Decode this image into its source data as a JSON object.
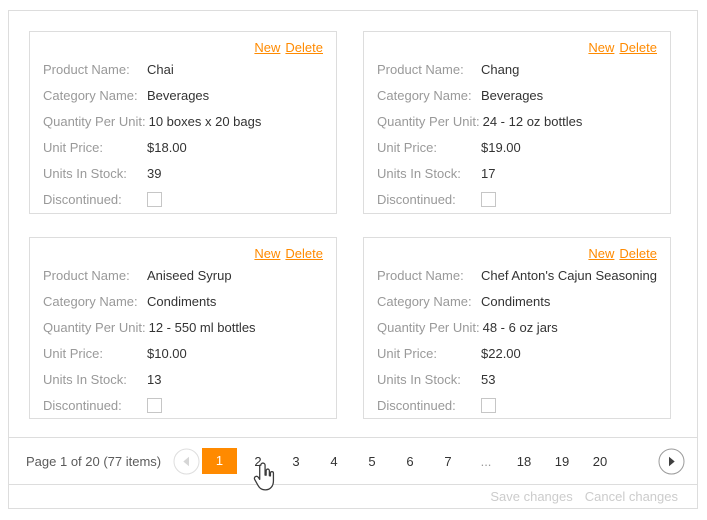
{
  "theme": {
    "accent": "#ff8a00",
    "border_color": "#dddddd",
    "label_color": "#999999",
    "value_color": "#333333",
    "disabled_link_color": "#cccccc"
  },
  "cards": [
    {
      "links": {
        "new": "New",
        "delete": "Delete"
      },
      "fields": [
        {
          "label": "Product Name:",
          "value": "Chai"
        },
        {
          "label": "Category Name:",
          "value": "Beverages"
        },
        {
          "label": "Quantity Per Unit:",
          "value": "10 boxes x 20 bags"
        },
        {
          "label": "Unit Price:",
          "value": "$18.00"
        },
        {
          "label": "Units In Stock:",
          "value": "39"
        }
      ],
      "discontinued_label": "Discontinued:",
      "discontinued": false
    },
    {
      "links": {
        "new": "New",
        "delete": "Delete"
      },
      "fields": [
        {
          "label": "Product Name:",
          "value": "Chang"
        },
        {
          "label": "Category Name:",
          "value": "Beverages"
        },
        {
          "label": "Quantity Per Unit:",
          "value": "24 - 12 oz bottles"
        },
        {
          "label": "Unit Price:",
          "value": "$19.00"
        },
        {
          "label": "Units In Stock:",
          "value": "17"
        }
      ],
      "discontinued_label": "Discontinued:",
      "discontinued": false
    },
    {
      "links": {
        "new": "New",
        "delete": "Delete"
      },
      "fields": [
        {
          "label": "Product Name:",
          "value": "Aniseed Syrup"
        },
        {
          "label": "Category Name:",
          "value": "Condiments"
        },
        {
          "label": "Quantity Per Unit:",
          "value": "12 - 550 ml bottles"
        },
        {
          "label": "Unit Price:",
          "value": "$10.00"
        },
        {
          "label": "Units In Stock:",
          "value": "13"
        }
      ],
      "discontinued_label": "Discontinued:",
      "discontinued": false
    },
    {
      "links": {
        "new": "New",
        "delete": "Delete"
      },
      "fields": [
        {
          "label": "Product Name:",
          "value": "Chef Anton's Cajun Seasoning"
        },
        {
          "label": "Category Name:",
          "value": "Condiments"
        },
        {
          "label": "Quantity Per Unit:",
          "value": "48 - 6 oz jars"
        },
        {
          "label": "Unit Price:",
          "value": "$22.00"
        },
        {
          "label": "Units In Stock:",
          "value": "53"
        }
      ],
      "discontinued_label": "Discontinued:",
      "discontinued": false
    }
  ],
  "pager": {
    "info": "Page 1 of 20 (77 items)",
    "current_page": "1",
    "pages": [
      "1",
      "2",
      "3",
      "4",
      "5",
      "6",
      "7",
      "...",
      "18",
      "19",
      "20"
    ],
    "prev_icon": "left-triangle-circle",
    "next_icon": "right-triangle-circle"
  },
  "footer": {
    "save": "Save changes",
    "cancel": "Cancel changes"
  }
}
